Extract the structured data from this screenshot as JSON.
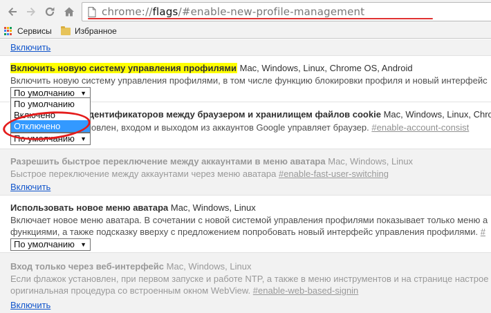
{
  "browser": {
    "url_scheme": "chrome://",
    "url_host": "flags",
    "url_path": "/#enable-new-profile-management"
  },
  "bookmarks": [
    {
      "label": "Сервисы",
      "icon": "apps-grid-icon"
    },
    {
      "label": "Избранное",
      "icon": "folder-icon"
    }
  ],
  "colors": {
    "highlight": "#ffff00",
    "link": "#1155cc",
    "selected_option": "#3399ff",
    "annotation_ring": "#e41c1c"
  },
  "flags": [
    {
      "id": "prev",
      "link": "Включить"
    },
    {
      "id": "new-profile-management",
      "title": "Включить новую систему управления профилями",
      "platforms": "Mac, Windows, Linux, Chrome OS, Android",
      "description": "Включить новую систему управления профилями, в том числе функцию блокировки профиля и новый интерфейс",
      "select_value": "По умолчанию",
      "dropdown_options": [
        "По умолчанию",
        "Включено",
        "Отключено"
      ],
      "dropdown_selected_index": 2
    },
    {
      "id": "account-consistency",
      "title": "Синхронизация идентификаторов между браузером и хранилищем файлов cookie",
      "platforms": "Mac, Windows, Linux, Chro",
      "description": "Если флажок установлен, входом и выходом из аккаунтов Google управляет браузер.",
      "anchor": "#enable-account-consist",
      "select_value": "По умолчанию"
    },
    {
      "id": "fast-user-switching",
      "title": "Разрешить быстрое переключение между аккаунтами в меню аватара",
      "platforms": "Mac, Windows, Linux",
      "description": "Быстрое переключение между аккаунтами через меню аватара",
      "anchor": "#enable-fast-user-switching",
      "link": "Включить"
    },
    {
      "id": "new-avatar-menu",
      "title": "Использовать новое меню аватара",
      "platforms": "Mac, Windows, Linux",
      "description_1": "Включает новое меню аватара. В сочетании с новой системой управления профилями показывает только меню а",
      "description_2": "функциями, а также подсказку вверху с предложением попробовать новый интерфейс управления профилями.",
      "anchor": "#",
      "select_value": "По умолчанию"
    },
    {
      "id": "web-based-signin",
      "title": "Вход только через веб-интерфейс",
      "platforms": "Mac, Windows, Linux",
      "description_1": "Если флажок установлен, при первом запуске и работе NTP, а также в меню инструментов и на странице настрое",
      "description_2": "оригинальная процедура со встроенным окном WebView.",
      "anchor": "#enable-web-based-signin",
      "link": "Включить"
    }
  ]
}
